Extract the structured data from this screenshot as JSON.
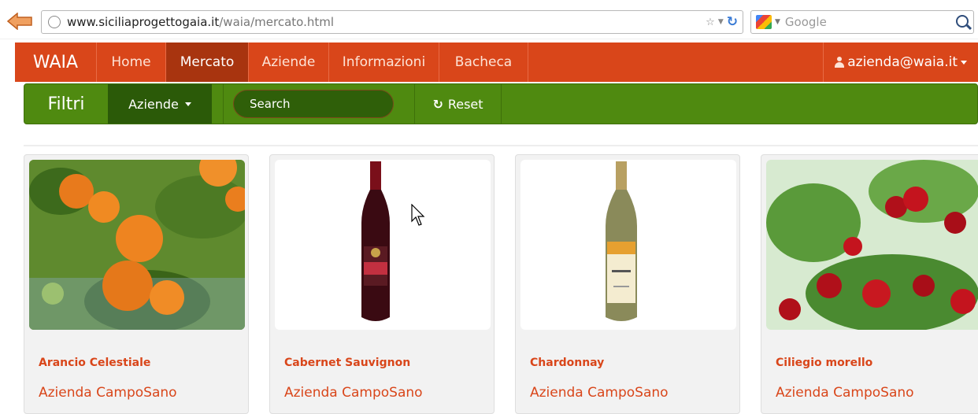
{
  "browser": {
    "url_domain": "www.siciliaprogettogaia.it",
    "url_path": "/waia/mercato.html",
    "search_placeholder": "Google"
  },
  "navbar": {
    "brand": "WAIA",
    "items": [
      {
        "label": "Home",
        "active": false
      },
      {
        "label": "Mercato",
        "active": true
      },
      {
        "label": "Aziende",
        "active": false
      },
      {
        "label": "Informazioni",
        "active": false
      },
      {
        "label": "Bacheca",
        "active": false
      }
    ],
    "user": "azienda@waia.it"
  },
  "filters": {
    "title": "Filtri",
    "dropdown": "Aziende",
    "search_placeholder": "Search",
    "reset": "Reset"
  },
  "products": [
    {
      "name": "Arancio Celestiale",
      "company": "Azienda CampoSano",
      "image": "orange-tree"
    },
    {
      "name": "Cabernet Sauvignon",
      "company": "Azienda CampoSano",
      "image": "red-wine-bottle"
    },
    {
      "name": "Chardonnay",
      "company": "Azienda CampoSano",
      "image": "white-wine-bottle"
    },
    {
      "name": "Ciliegio morello",
      "company": "Azienda CampoSano",
      "image": "cherry-tree"
    }
  ],
  "colors": {
    "primary": "#d9461a",
    "primary_active": "#a8340f",
    "filter_bar": "#4f8a10",
    "filter_dark": "#2b5a08"
  }
}
